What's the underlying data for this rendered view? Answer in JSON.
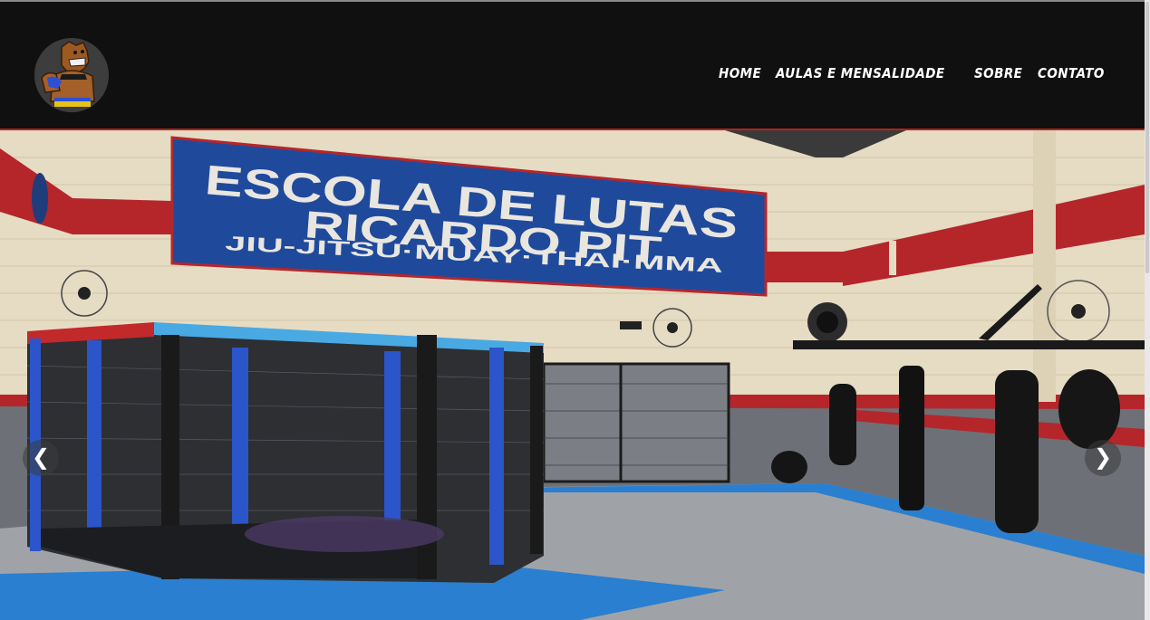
{
  "nav": {
    "items": [
      "HOME",
      "AULAS E MENSALIDADE",
      "SOBRE",
      "CONTATO"
    ]
  },
  "hero": {
    "sign_line1": "ESCOLA DE LUTAS",
    "sign_line2": "RICARDO PIT",
    "sign_line3": "JIU-JITSU·MUAY·THAI·MMA",
    "prev_label": "❮",
    "next_label": "❯"
  },
  "colors": {
    "header_bg": "#101010",
    "accent_red": "#b3241c",
    "sign_blue": "#1f4a9c",
    "mat_blue": "#2a7fd0"
  },
  "icons": [
    "bulldog-logo-icon",
    "chevron-left-icon",
    "chevron-right-icon"
  ]
}
